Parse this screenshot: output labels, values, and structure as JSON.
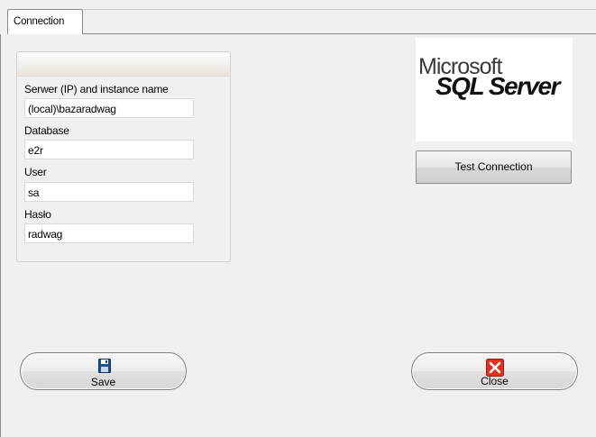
{
  "tabs": [
    {
      "label": "Connection"
    }
  ],
  "form": {
    "server_label": "Serwer (IP) and instance name",
    "server_value": "(local)\\bazaradwag",
    "database_label": "Database",
    "database_value": "e2r",
    "user_label": "User",
    "user_value": "sa",
    "password_label": "Hasło",
    "password_value": "radwag"
  },
  "logo": {
    "line1": "Microsoft",
    "line2": "SQL Server"
  },
  "buttons": {
    "test_connection": "Test Connection",
    "save": "Save",
    "close": "Close"
  },
  "colors": {
    "close_icon": "#e0301e",
    "save_icon": "#1f4f8f"
  }
}
